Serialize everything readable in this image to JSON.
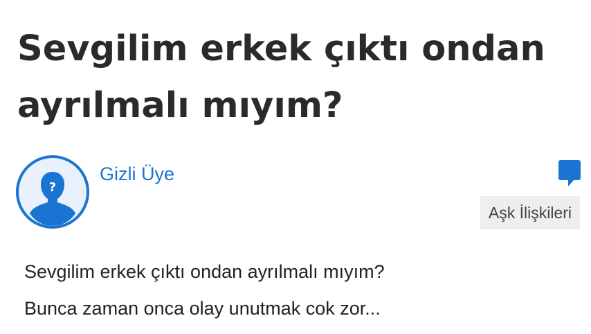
{
  "question": {
    "title": "Sevgilim erkek çıktı ondan ayrılmalı mıyım?",
    "author": "Gizli Üye",
    "category": "Aşk İlişkileri",
    "body_lines": [
      "Sevgilim erkek çıktı ondan ayrılmalı mıyım?",
      "Bunca zaman onca olay unutmak cok zor..."
    ]
  },
  "icons": {
    "avatar": "anonymous-user-icon",
    "comment": "comment-bubble-icon"
  },
  "colors": {
    "accent": "#1a74d2",
    "title": "#2a2a2a",
    "category_bg": "#eeeeee"
  }
}
